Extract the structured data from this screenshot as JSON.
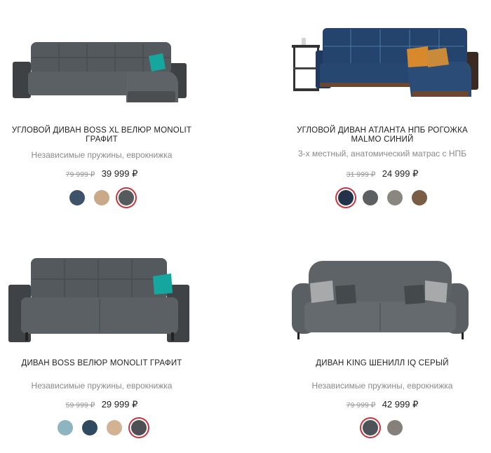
{
  "products": [
    {
      "title": "УГЛОВОЙ ДИВАН BOSS XL ВЕЛЮР MONOLIT ГРАФИТ",
      "subtitle": "Независимые пружины, еврокнижка",
      "old_price": "79 999 ₽",
      "price": "39 999 ₽",
      "swatches": [
        {
          "color": "#3e5369",
          "selected": false
        },
        {
          "color": "#c9a988",
          "selected": false
        },
        {
          "color": "#555a5c",
          "selected": true
        }
      ]
    },
    {
      "title": "УГЛОВОЙ ДИВАН АТЛАНТА НПБ РОГОЖКА MALMO СИНИЙ",
      "subtitle": "3-х местный, анатомический матрас с НПБ",
      "old_price": "31 999 ₽",
      "price": "24 999 ₽",
      "swatches": [
        {
          "color": "#23344a",
          "selected": true
        },
        {
          "color": "#5d6062",
          "selected": false
        },
        {
          "color": "#8b8680",
          "selected": false
        },
        {
          "color": "#7a5d45",
          "selected": false
        }
      ]
    },
    {
      "title": "ДИВАН BOSS ВЕЛЮР MONOLIT ГРАФИТ",
      "subtitle": "Независимые пружины, еврокнижка",
      "old_price": "59 999 ₽",
      "price": "29 999 ₽",
      "swatches": [
        {
          "color": "#8eb4c0",
          "selected": false
        },
        {
          "color": "#2f4a60",
          "selected": false
        },
        {
          "color": "#d3b193",
          "selected": false
        },
        {
          "color": "#4d5155",
          "selected": true
        }
      ]
    },
    {
      "title": "ДИВАН KING ШЕНИЛЛ IQ СЕРЫЙ",
      "subtitle": "Независимые пружины, еврокнижка",
      "old_price": "79 999 ₽",
      "price": "42 999 ₽",
      "swatches": [
        {
          "color": "#4e5357",
          "selected": true
        },
        {
          "color": "#85807a",
          "selected": false
        }
      ]
    }
  ],
  "colors": {
    "selected_ring": "#c9343b"
  }
}
